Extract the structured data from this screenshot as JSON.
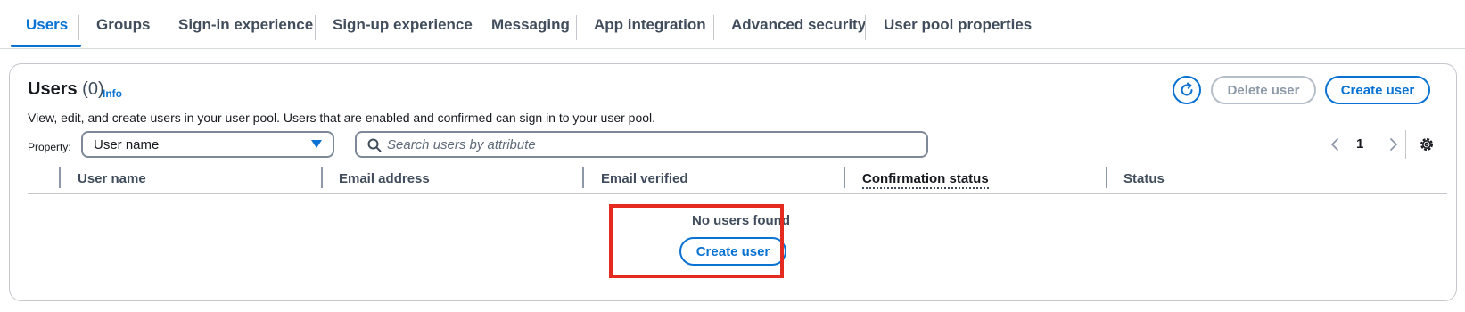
{
  "tabs": [
    {
      "label": "Users",
      "active": true
    },
    {
      "label": "Groups"
    },
    {
      "label": "Sign-in experience"
    },
    {
      "label": "Sign-up experience"
    },
    {
      "label": "Messaging"
    },
    {
      "label": "App integration"
    },
    {
      "label": "Advanced security"
    },
    {
      "label": "User pool properties"
    }
  ],
  "panel": {
    "title": "Users",
    "count": "(0)",
    "info_link": "Info",
    "description": "View, edit, and create users in your user pool. Users that are enabled and confirmed can sign in to your user pool.",
    "refresh_icon": "refresh-icon",
    "delete_button": "Delete user",
    "create_button": "Create user"
  },
  "filters": {
    "property_label": "Property:",
    "property_value": "User name",
    "search_placeholder": "Search users by attribute"
  },
  "pagination": {
    "current_page": "1"
  },
  "table": {
    "columns": [
      "User name",
      "Email address",
      "Email verified",
      "Confirmation status",
      "Status"
    ],
    "empty_title": "No users found",
    "empty_button": "Create user"
  },
  "colors": {
    "accent": "#0972d3",
    "highlight": "#e52b20",
    "disabled": "#8d99a8"
  }
}
